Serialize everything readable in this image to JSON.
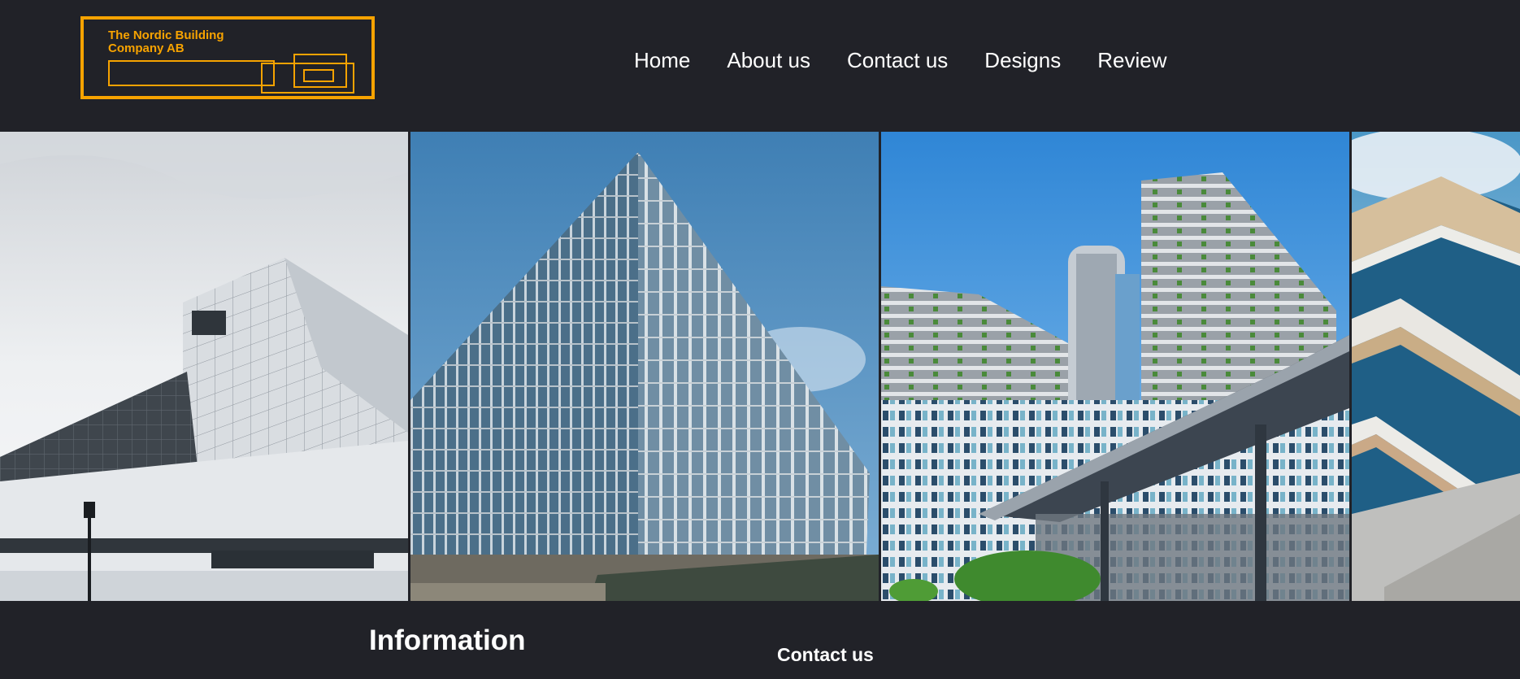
{
  "logo": {
    "line1": "The Nordic Building",
    "line2": "Company AB",
    "color": "#f7a300"
  },
  "nav": {
    "items": [
      "Home",
      "About us",
      "Contact us",
      "Designs",
      "Review"
    ]
  },
  "gallery": {
    "photos": [
      {
        "alt": "white angular building against cloudy sky"
      },
      {
        "alt": "glass cube office building under blue sky"
      },
      {
        "alt": "curvy terraced green residential towers with walkway"
      },
      {
        "alt": "close-up of tiered balconies with blue glass"
      }
    ]
  },
  "footer": {
    "information_heading": "Information",
    "contact_heading": "Contact us"
  },
  "colors": {
    "background": "#212228",
    "accent": "#f7a300",
    "text": "#ffffff"
  }
}
